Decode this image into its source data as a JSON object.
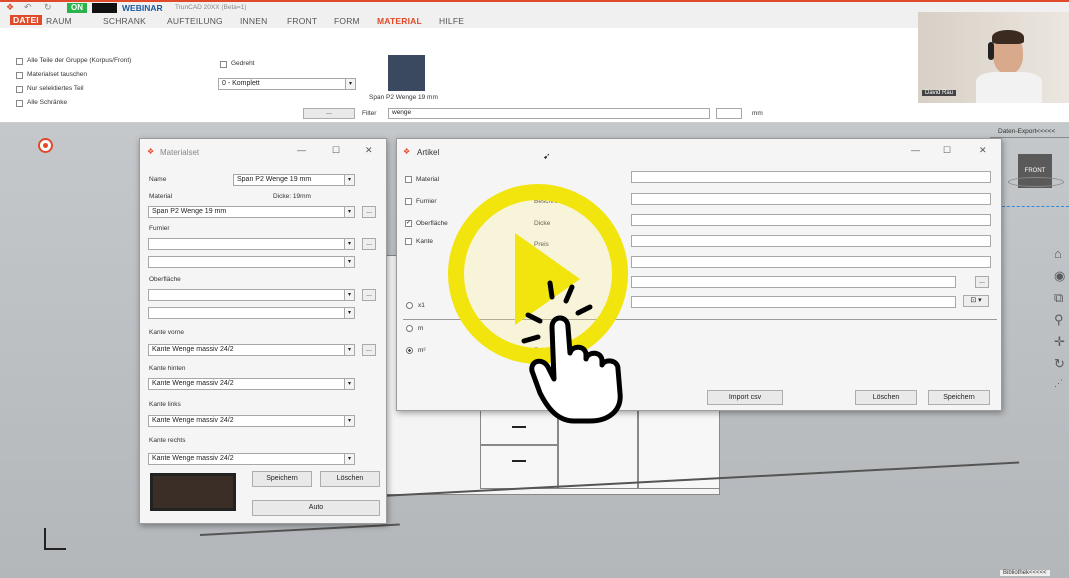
{
  "app": {
    "on_label": "ON",
    "brand": "WEBINAR",
    "app_title": "TrunCAD 20XX (Beta=1)"
  },
  "ribbon_tabs": [
    "DATEI",
    "RAUM",
    "SCHRANK",
    "AUFTEILUNG",
    "INNEN",
    "FRONT",
    "FORM",
    "MATERIAL",
    "HILFE"
  ],
  "ribbon": {
    "opt_group": "Alle Teile der Gruppe (Korpus/Front)",
    "opt_swap": "Materialset tauschen",
    "opt_selected": "Nur selektiertes Teil",
    "opt_all": "Alle Schränke",
    "rotated_label": "Gedreht",
    "komplett_value": "0 - Komplett",
    "material_label": "Span P2 Wenge 19 mm",
    "filter_label": "Filter",
    "filter_value": "wenge",
    "unit": "mm",
    "dots": "..."
  },
  "webcam": {
    "name": "David Rau"
  },
  "daten_export": "Daten-Export<<<<<",
  "view_cube": "FRONT",
  "materialset": {
    "title": "Materialset",
    "name_label": "Name",
    "name_value": "Span P2 Wenge 19 mm",
    "material_label": "Material",
    "dicke_label": "Dicke: 19mm",
    "material_value": "Span P2 Wenge 19 mm",
    "furnier_label": "Furnier",
    "oberflaeche_label": "Oberfläche",
    "kante_vorne_label": "Kante vorne",
    "kante_vorne_value": "Kante Wenge massiv 24/2",
    "kante_hinten_label": "Kante hinten",
    "kante_hinten_value": "Kante Wenge massiv 24/2",
    "kante_links_label": "Kante links",
    "kante_links_value": "Kante Wenge massiv 24/2",
    "kante_rechts_label": "Kante rechts",
    "kante_rechts_value": "Kante Wenge massiv 24/2",
    "save": "Speichern",
    "delete": "Löschen",
    "auto": "Auto"
  },
  "artikel": {
    "title": "Artikel",
    "chk_material": "Material",
    "chk_furnier": "Furnier",
    "chk_oberflaeche": "Oberfläche",
    "chk_kante": "Kante",
    "f_beschreibung": "Beschreibung",
    "f_dicke": "Dicke",
    "f_preis": "Preis",
    "radio_x1": "x1",
    "radio_m": "m",
    "radio_m2": "m²",
    "rohlaenge": "Rohlänge",
    "import": "Import csv",
    "delete": "Löschen",
    "save": "Speichern"
  },
  "bottom_right": "Bibliothek<<<<<",
  "colors": {
    "accent": "#e04a2a",
    "play": "#f2e40d"
  }
}
